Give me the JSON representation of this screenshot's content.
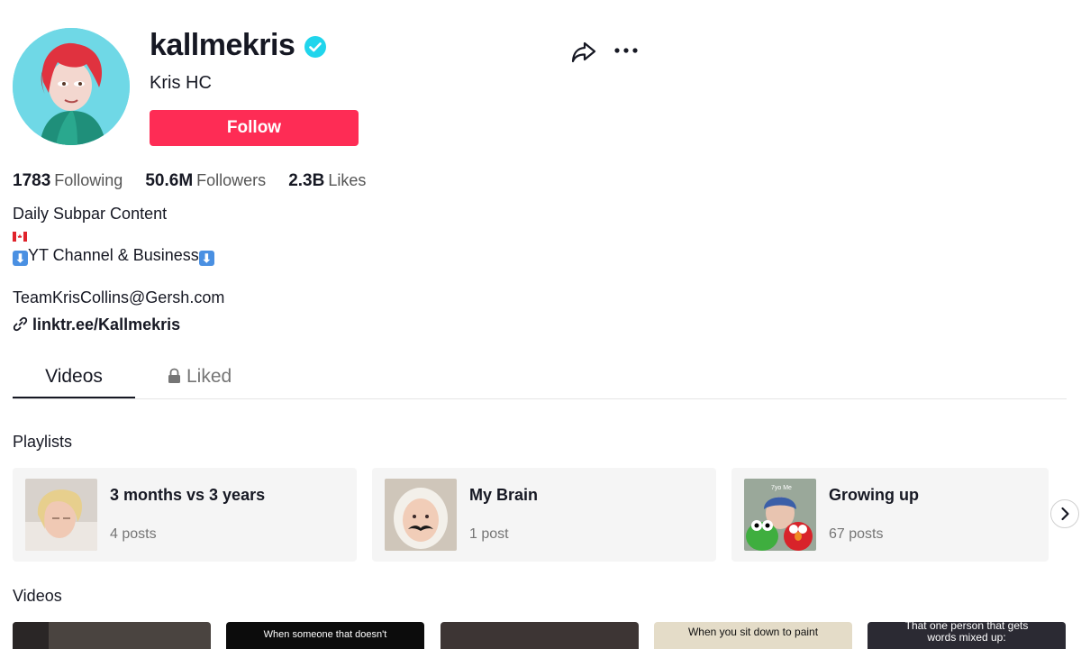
{
  "profile": {
    "username": "kallmekris",
    "nickname": "Kris HC",
    "follow_label": "Follow",
    "verified": true
  },
  "stats": [
    {
      "value": "1783",
      "label": "Following"
    },
    {
      "value": "50.6M",
      "label": "Followers"
    },
    {
      "value": "2.3B",
      "label": "Likes"
    }
  ],
  "bio": {
    "line1": "Daily Subpar Content",
    "line3": "YT Channel & Business",
    "email": "TeamKrisCollins@Gersh.com",
    "link": "linktr.ee/Kallmekris"
  },
  "tabs": {
    "videos": "Videos",
    "liked": "Liked"
  },
  "playlists": {
    "title": "Playlists",
    "items": [
      {
        "title": "3 months vs 3 years",
        "count": "4 posts"
      },
      {
        "title": "My Brain",
        "count": "1 post"
      },
      {
        "title": "Growing up",
        "count": "67 posts",
        "thumb_text": "7yo Me"
      }
    ]
  },
  "videos": {
    "title": "Videos",
    "items": [
      {
        "caption": ""
      },
      {
        "caption": "When someone that doesn't"
      },
      {
        "caption": ""
      },
      {
        "caption": "When you sit down to paint"
      },
      {
        "caption": "That one person that gets words mixed up:"
      }
    ]
  },
  "colors": {
    "accent": "#fe2c55",
    "verified": "#20d5ec",
    "text": "#161823",
    "muted": "#757575"
  },
  "icons": [
    "verified-badge-icon",
    "share-icon",
    "more-icon",
    "link-icon",
    "lock-icon",
    "chevron-right-icon"
  ]
}
